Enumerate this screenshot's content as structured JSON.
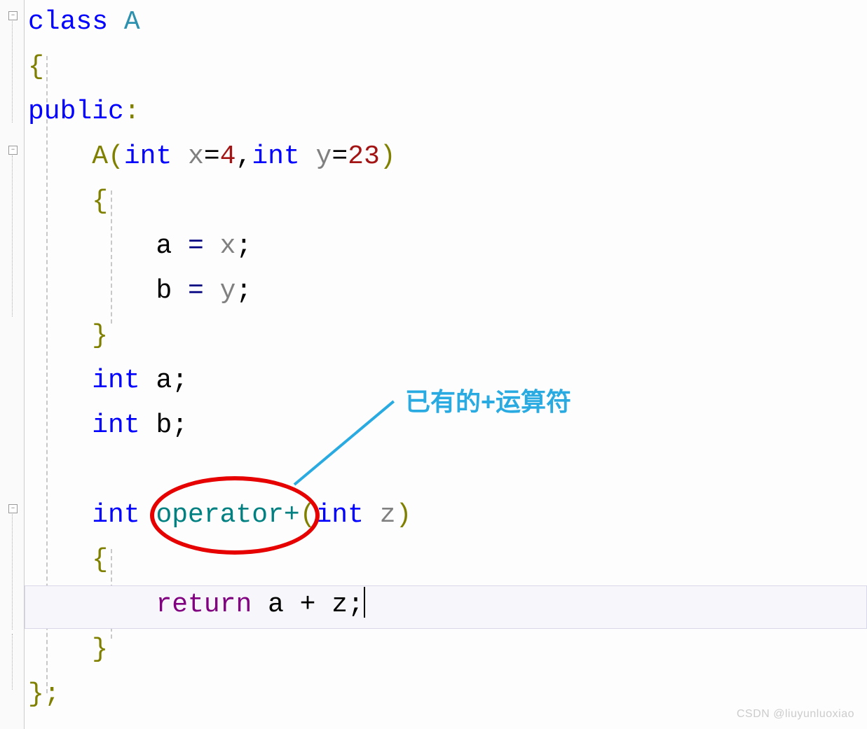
{
  "code": {
    "l1": {
      "class_kw": "class",
      "class_name": " A"
    },
    "l2": "{",
    "l3": {
      "public": "public",
      "colon": ":"
    },
    "l4": {
      "ctor": "A",
      "p1": "(",
      "t1": "int ",
      "x": "x",
      "eq1": "=",
      "v1": "4",
      "comma": ",",
      "t2": "int ",
      "y": "y",
      "eq2": "=",
      "v2": "23",
      "p2": ")"
    },
    "l5": "    {",
    "l6": {
      "indent": "        ",
      "a": "a ",
      "eq": "= ",
      "x": "x",
      "semi": ";"
    },
    "l7": {
      "indent": "        ",
      "b": "b ",
      "eq": "= ",
      "y": "y",
      "semi": ";"
    },
    "l8": "    }",
    "l9": {
      "indent": "    ",
      "t": "int ",
      "v": "a",
      "semi": ";"
    },
    "l10": {
      "indent": "    ",
      "t": "int ",
      "v": "b",
      "semi": ";"
    },
    "l11": "",
    "l12": {
      "indent": "    ",
      "t": "int ",
      "op": "operator",
      "plus": "+",
      "p1": "(",
      "t2": "int ",
      "z": "z",
      "p2": ")"
    },
    "l13": "    {",
    "l14": {
      "indent": "        ",
      "ret": "return ",
      "expr": "a + z",
      "semi": ";"
    },
    "l15": "    }",
    "l16": "};"
  },
  "annotation": {
    "label": "已有的+运算符"
  },
  "watermark": "CSDN @liuyunluoxiao"
}
